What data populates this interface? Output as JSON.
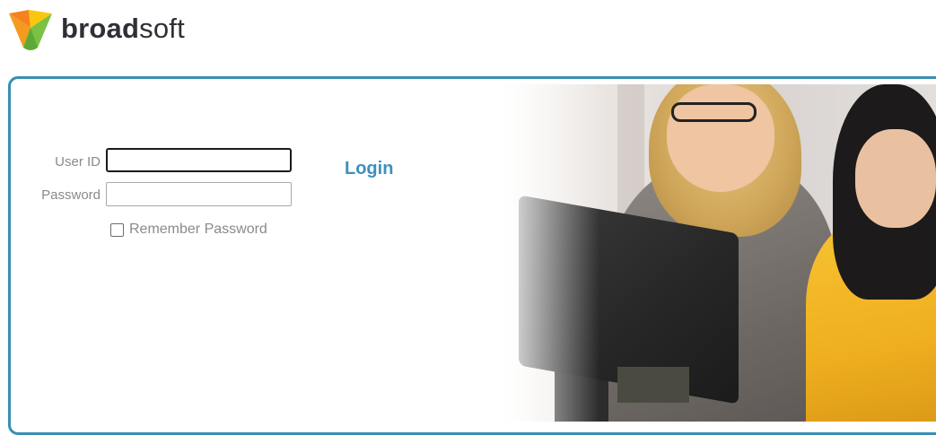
{
  "brand": {
    "name_bold": "broad",
    "name_regular": "soft",
    "colors": {
      "logo_orange": "#f5821f",
      "logo_yellow": "#f9c80e",
      "logo_green": "#7cc142",
      "logo_text": "#2f2f36"
    }
  },
  "login_form": {
    "user_id_label": "User ID",
    "user_id_value": "",
    "password_label": "Password",
    "password_value": "",
    "remember_label": "Remember Password",
    "remember_checked": false,
    "login_label": "Login"
  },
  "theme": {
    "panel_border": "#3a8fb4",
    "login_link_color": "#3c8fbf",
    "label_color": "#8a8a8a"
  },
  "hero_image": {
    "icon": "photo-two-women-at-computer"
  }
}
